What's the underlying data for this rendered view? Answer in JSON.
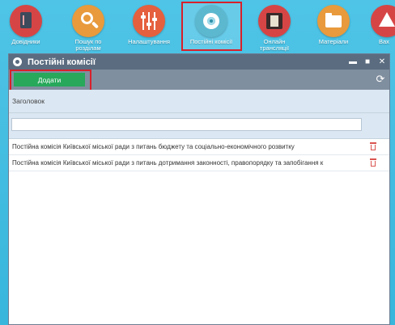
{
  "launcher": {
    "apps": [
      {
        "label": "Довідники",
        "color": "#d64545"
      },
      {
        "label": "Пошук по розділам",
        "color": "#e89a3c"
      },
      {
        "label": "Налаштування",
        "color": "#e5603e"
      },
      {
        "label": "Постійні комісії",
        "color": "#5cb8cf",
        "selected": true
      },
      {
        "label": "Онлайн трансляції",
        "color": "#d64545"
      },
      {
        "label": "Матеріали",
        "color": "#e89a3c"
      },
      {
        "label": "Вах",
        "color": "#d64545"
      }
    ]
  },
  "window": {
    "title": "Постійні комісії",
    "controls": {
      "minimize": "▬",
      "maximize": "■",
      "close": "✕"
    },
    "toolbar": {
      "add_label": "Додати",
      "refresh_icon": "refresh-icon"
    },
    "grid": {
      "column_header": "Заголовок",
      "filter_value": "",
      "rows": [
        {
          "title": "Постійна комісія Київської міської ради з питань бюджету та соціально-економічного розвитку"
        },
        {
          "title": "Постійна комісія Київської міської ради з питань дотримання законності, правопорядку та запобігання к"
        }
      ]
    }
  },
  "colors": {
    "background": "#42bde2",
    "titlebar": "#5b6c80",
    "toolbar": "#808f9f",
    "add_button": "#27a85b",
    "highlight": "#d8202a",
    "trash": "#d9534f"
  }
}
